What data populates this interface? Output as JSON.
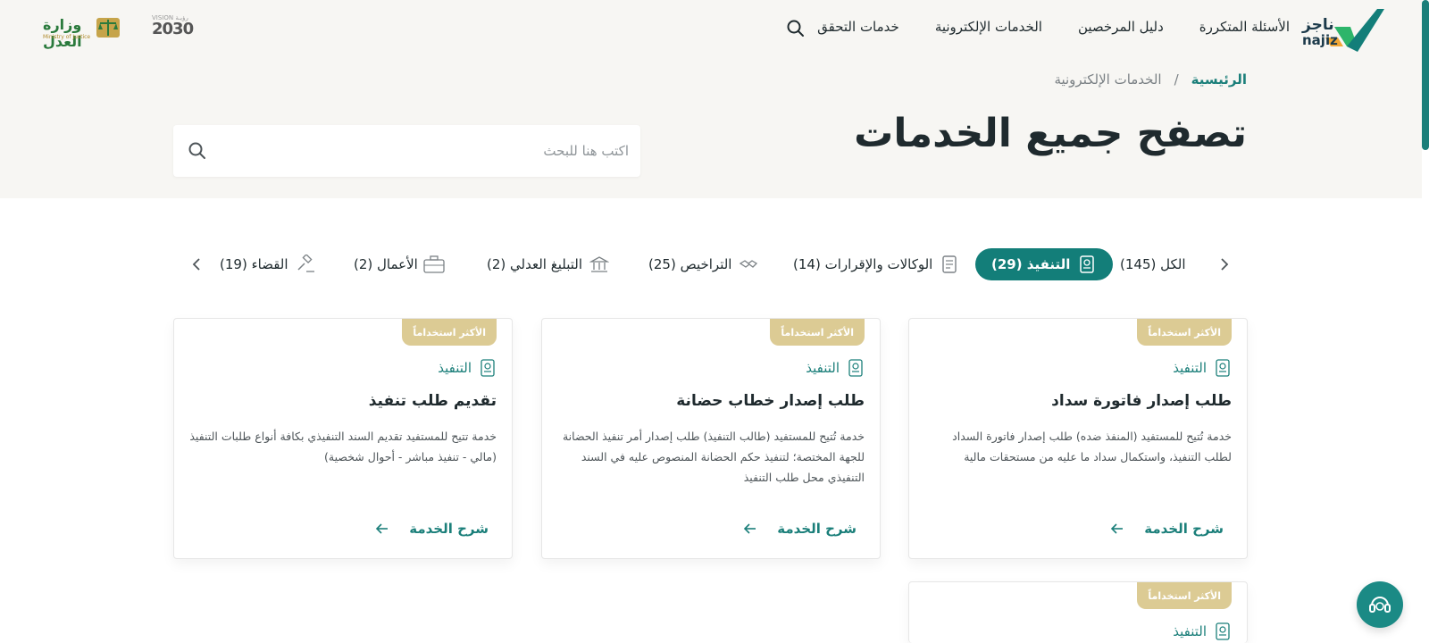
{
  "header": {
    "logo_text_ar": "ناجز",
    "logo_text_en": "najiz",
    "nav": [
      "خدمات التحقق",
      "الخدمات الإلكترونية",
      "دليل المرخصين",
      "الأسئلة المتكررة"
    ],
    "vision_top": "VISION رؤيـة",
    "vision_year": "2030",
    "moj_ar": "وزارة العدل",
    "moj_en": "Ministry of Justice"
  },
  "breadcrumb": {
    "home": "الرئيسية",
    "separator": "/",
    "current": "الخدمات الإلكترونية"
  },
  "page_title": "تصفح جميع الخدمات",
  "search": {
    "placeholder": "اكتب هنا للبحث"
  },
  "tabs": [
    {
      "label": "الكل (145)"
    },
    {
      "label": "التنفيذ (29)"
    },
    {
      "label": "الوكالات والإقرارات (14)"
    },
    {
      "label": "التراخيص (25)"
    },
    {
      "label": "التبليغ العدلي (2)"
    },
    {
      "label": "الأعمال (2)"
    },
    {
      "label": "القضاء (19)"
    }
  ],
  "cards": [
    {
      "badge": "الأكثر استخداماً",
      "category": "التنفيذ",
      "title": "طلب إصدار فاتورة سداد",
      "description": "خدمة تُتيح للمستفيد (المنفذ ضده) طلب إصدار فاتورة السداد لطلب التنفيذ، واستكمال سداد ما عليه من مستحقات مالية",
      "link": "شرح الخدمة"
    },
    {
      "badge": "الأكثر استخداماً",
      "category": "التنفيذ",
      "title": "طلب إصدار خطاب حضانة",
      "description": "خدمة تُتيح للمستفيد (طالب التنفيذ) طلب إصدار أمر تنفيذ الحضانة للجهة المختصة؛ لتنفيذ حكم الحضانة المنصوص عليه في السند التنفيذي محل طلب التنفيذ",
      "link": "شرح الخدمة"
    },
    {
      "badge": "الأكثر استخداماً",
      "category": "التنفيذ",
      "title": "تقديم طلب تنفيذ",
      "description": "خدمة تتيح للمستفيد تقديم السند التنفيذي بكافة أنواع طلبات التنفيذ (مالي - تنفيذ مباشر - أحوال شخصية)",
      "link": "شرح الخدمة"
    },
    {
      "badge": "الأكثر استخداماً",
      "category": "التنفيذ"
    }
  ],
  "colors": {
    "primary": "#137e79",
    "badge": "#dccb94",
    "hero_bg": "#f7f6f3"
  }
}
